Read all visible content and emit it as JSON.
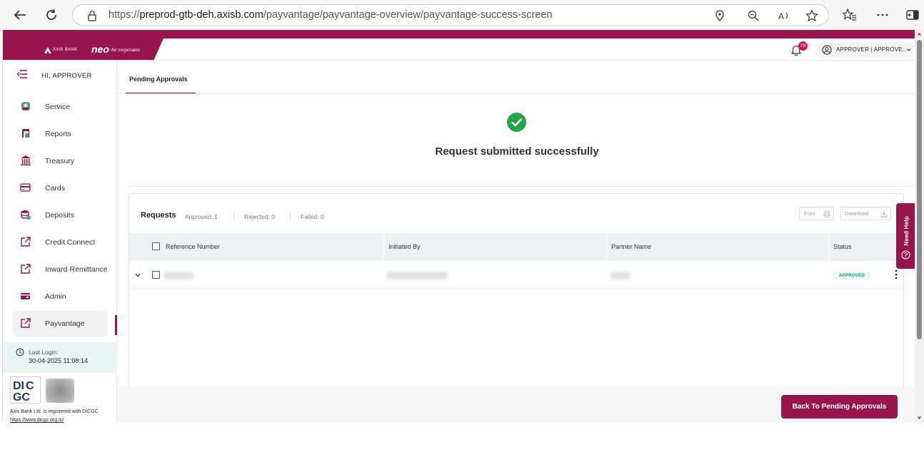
{
  "browser": {
    "url_prefix": "https://",
    "url_host": "preprod-gtb-deh.axisb.com",
    "url_path": "/payvantage/payvantage-overview/payvantage-success-screen"
  },
  "header": {
    "bank_name": "AXIS BANK",
    "product_name": "neo",
    "product_tagline": "for corporates",
    "notification_count": "79",
    "user_label": "APPROVER | APPROVE..."
  },
  "sidebar": {
    "greeting": "HI, APPROVER",
    "items": [
      {
        "label": "Service",
        "icon": "service-icon"
      },
      {
        "label": "Reports",
        "icon": "reports-icon"
      },
      {
        "label": "Treasury",
        "icon": "treasury-icon"
      },
      {
        "label": "Cards",
        "icon": "cards-icon"
      },
      {
        "label": "Deposits",
        "icon": "deposits-icon"
      },
      {
        "label": "Credit Connect",
        "icon": "external-link-icon"
      },
      {
        "label": "Inward Remittance",
        "icon": "external-link-icon"
      },
      {
        "label": "Admin",
        "icon": "admin-icon"
      },
      {
        "label": "Payvantage",
        "icon": "external-link-icon",
        "active": true
      }
    ],
    "last_login_label": "Last Login:",
    "last_login_value": "30-04-2025  11:08:14",
    "dicgc_text": "Axis Bank Ltd. is registered with DICGC",
    "dicgc_link": "https://www.dicgc.org.in/"
  },
  "main": {
    "tab_label": "Pending Approvals",
    "success_message": "Request submitted successfully",
    "requests": {
      "title": "Requests",
      "approved": "Approved: 1",
      "rejected": "Rejected: 0",
      "failed": "Failed: 0",
      "print_label": "Print",
      "download_label": "Download",
      "columns": [
        "Reference Number",
        "Initiated By",
        "Partner Name",
        "Status"
      ],
      "rows": [
        {
          "status": "APPROVED"
        }
      ]
    },
    "back_button": "Back To Pending Approvals",
    "need_help": "Need Help"
  },
  "colors": {
    "brand": "#97144d",
    "success": "#22a447",
    "status_approved": "#1b9479"
  }
}
